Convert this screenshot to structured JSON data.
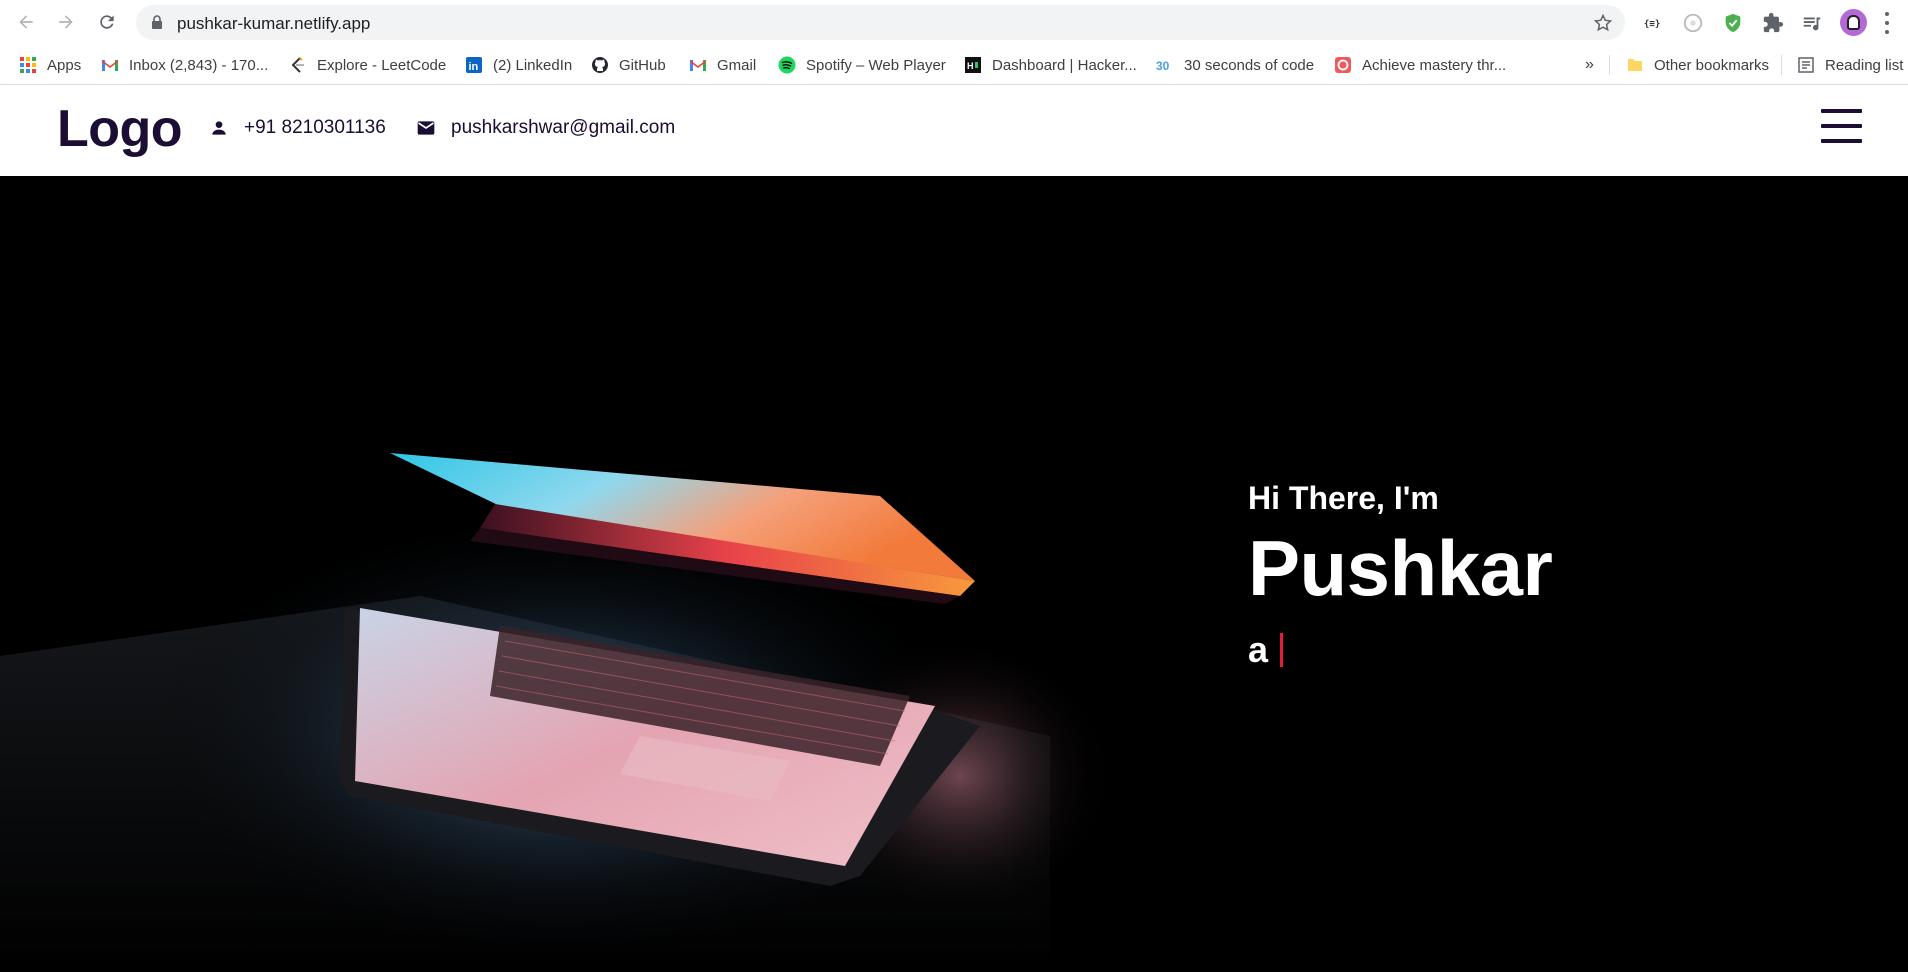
{
  "browser": {
    "url": "pushkar-kumar.netlify.app",
    "bookmarks": [
      {
        "label": "Apps",
        "icon": "apps-grid-icon"
      },
      {
        "label": "Inbox (2,843) - 170...",
        "icon": "gmail-icon"
      },
      {
        "label": "Explore - LeetCode",
        "icon": "leetcode-icon"
      },
      {
        "label": "(2) LinkedIn",
        "icon": "linkedin-icon"
      },
      {
        "label": "GitHub",
        "icon": "github-icon"
      },
      {
        "label": "Gmail",
        "icon": "gmail-icon"
      },
      {
        "label": "Spotify – Web Player",
        "icon": "spotify-icon"
      },
      {
        "label": "Dashboard | Hacker...",
        "icon": "hackerrank-icon"
      },
      {
        "label": "30 seconds of code",
        "icon": "30-seconds-icon"
      },
      {
        "label": "Achieve mastery thr...",
        "icon": "codecademy-icon"
      }
    ],
    "overflow_label": "»",
    "other_bookmarks": "Other bookmarks",
    "reading_list": "Reading list"
  },
  "header": {
    "logo": "Logo",
    "phone": "+91 8210301136",
    "email": "pushkarshwar@gmail.com"
  },
  "hero": {
    "greeting": "Hi There, I'm",
    "name": "Pushkar",
    "role_prefix": "a",
    "caret_color": "#e31b3d"
  },
  "colors": {
    "brand_dark": "#1b0d33",
    "hero_bg": "#000000"
  }
}
